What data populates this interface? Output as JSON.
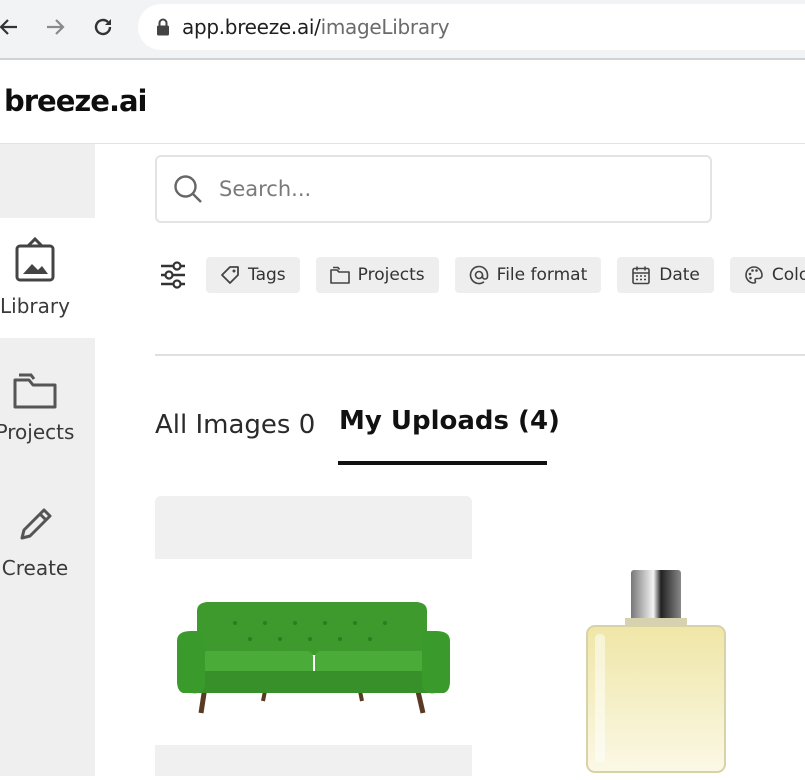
{
  "browser": {
    "url_host": "app.breeze.ai/",
    "url_path": "imageLibrary"
  },
  "app": {
    "logo": "breeze.ai"
  },
  "sidebar": {
    "items": [
      {
        "label": "Library",
        "icon": "library-icon",
        "active": true
      },
      {
        "label": "Projects",
        "icon": "folder-icon",
        "active": false
      },
      {
        "label": "Create",
        "icon": "pencil-icon",
        "active": false
      }
    ]
  },
  "search": {
    "placeholder": "Search..."
  },
  "filters": {
    "chips": [
      {
        "label": "Tags",
        "icon": "tag-icon"
      },
      {
        "label": "Projects",
        "icon": "folder-icon"
      },
      {
        "label": "File format",
        "icon": "at-icon"
      },
      {
        "label": "Date",
        "icon": "calendar-icon"
      },
      {
        "label": "Color",
        "icon": "palette-icon"
      }
    ]
  },
  "tabs": [
    {
      "label": "All Images 0",
      "active": false
    },
    {
      "label": "My Uploads (4)",
      "active": true
    }
  ],
  "gallery": {
    "items": [
      {
        "subject": "green sofa"
      },
      {
        "subject": "perfume bottle"
      }
    ]
  },
  "colors": {
    "sidebar_bg": "#efefef",
    "chip_bg": "#eeeeee",
    "active_underline": "#111111"
  }
}
